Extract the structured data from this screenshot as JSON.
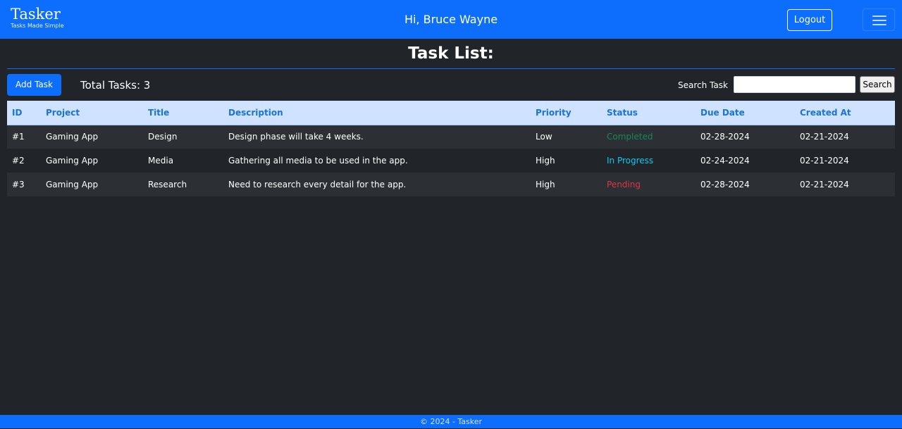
{
  "navbar": {
    "brand_name": "Tasker",
    "brand_tagline": "Tasks Made Simple",
    "greeting": "Hi, Bruce Wayne",
    "logout_label": "Logout",
    "menu_icon": "hamburger-icon"
  },
  "main": {
    "title": "Task List:",
    "add_task_label": "Add Task",
    "total_tasks": "Total Tasks: 3",
    "search_label": "Search Task",
    "search_value": "",
    "search_button_label": "Search"
  },
  "table": {
    "headers": [
      "ID",
      "Project",
      "Title",
      "Description",
      "Priority",
      "Status",
      "Due Date",
      "Created At"
    ],
    "rows": [
      {
        "id": "#1",
        "project": "Gaming App",
        "title": "Design",
        "description": "Design phase will take 4 weeks.",
        "priority": "Low",
        "status": "Completed",
        "due_date": "02-28-2024",
        "created_at": "02-21-2024"
      },
      {
        "id": "#2",
        "project": "Gaming App",
        "title": "Media",
        "description": "Gathering all media to be used in the app.",
        "priority": "High",
        "status": "In Progress",
        "due_date": "02-24-2024",
        "created_at": "02-21-2024"
      },
      {
        "id": "#3",
        "project": "Gaming App",
        "title": "Research",
        "description": "Need to research every detail for the app.",
        "priority": "High",
        "status": "Pending",
        "due_date": "02-28-2024",
        "created_at": "02-21-2024"
      }
    ]
  },
  "footer": {
    "text": "© 2024 - Tasker"
  },
  "colors": {
    "primary": "#0d6efd",
    "background": "#212529",
    "completed": "#198754",
    "in_progress": "#0dcaf0",
    "pending": "#dc3545"
  }
}
